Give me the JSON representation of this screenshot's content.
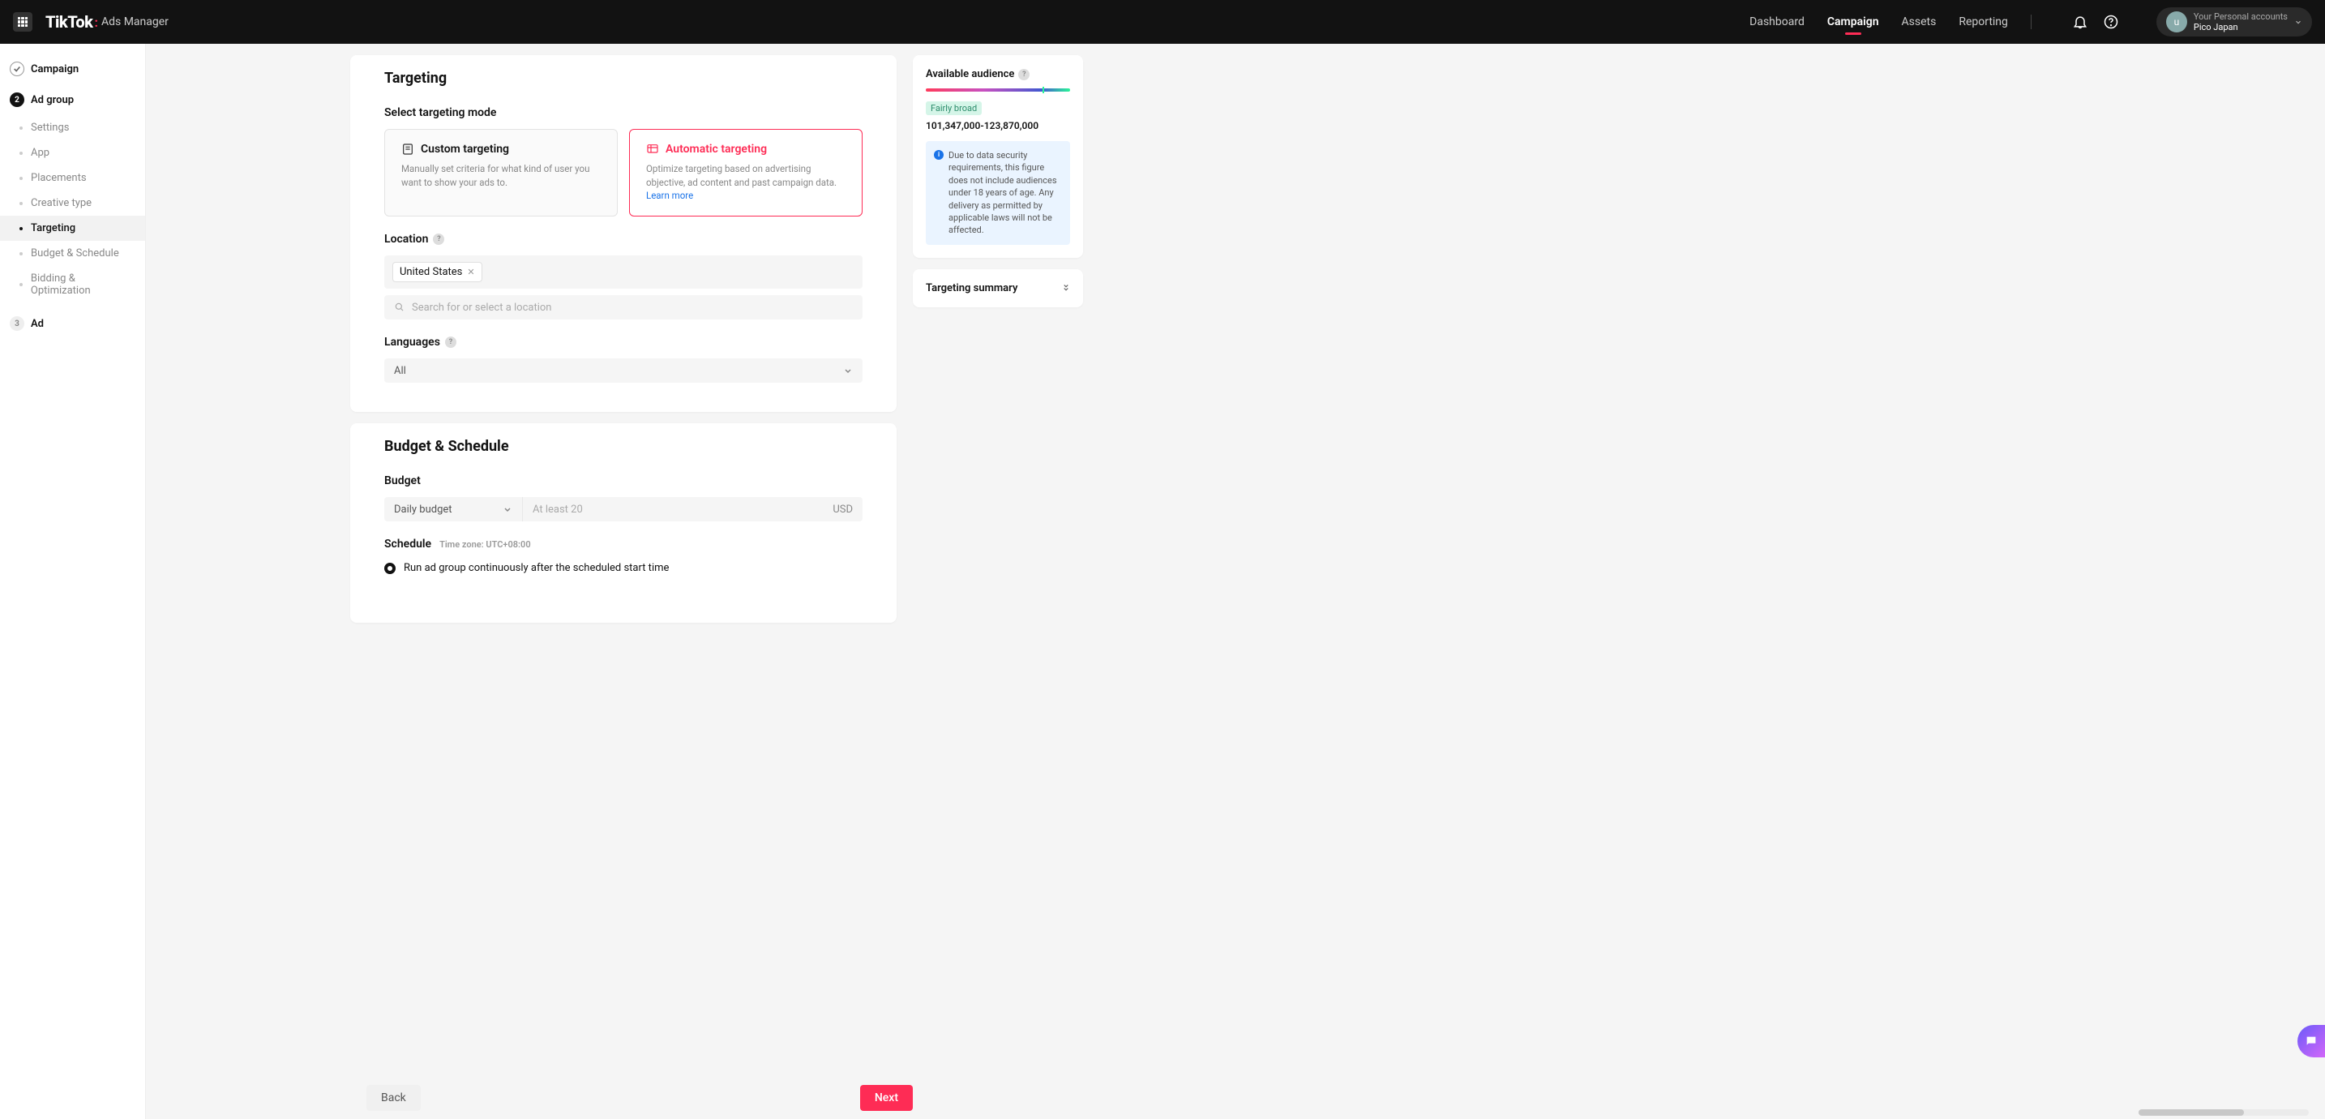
{
  "header": {
    "logo_prefix": "TikTok",
    "logo_suffix": "Ads Manager",
    "nav": {
      "dashboard": "Dashboard",
      "campaign": "Campaign",
      "assets": "Assets",
      "reporting": "Reporting"
    },
    "account": {
      "avatar_letter": "u",
      "line1": "Your Personal accounts",
      "line2": "Pico Japan"
    }
  },
  "sidebar": {
    "campaign_label": "Campaign",
    "adgroup_label": "Ad group",
    "adgroup_number": "2",
    "ad_label": "Ad",
    "ad_number": "3",
    "substeps": {
      "settings": "Settings",
      "app": "App",
      "placements": "Placements",
      "creative_type": "Creative type",
      "targeting": "Targeting",
      "budget_schedule": "Budget & Schedule",
      "bidding": "Bidding & Optimization"
    }
  },
  "targeting": {
    "heading": "Targeting",
    "mode_label": "Select targeting mode",
    "custom": {
      "title": "Custom targeting",
      "desc": "Manually set criteria for what kind of user you want to show your ads to."
    },
    "auto": {
      "title": "Automatic targeting",
      "desc": "Optimize targeting based on advertising objective, ad content and past campaign data. ",
      "learn_more": "Learn more"
    },
    "location_label": "Location",
    "location_chip": "United States",
    "location_search_placeholder": "Search for or select a location",
    "languages_label": "Languages",
    "languages_value": "All"
  },
  "budget_schedule": {
    "heading": "Budget & Schedule",
    "budget_label": "Budget",
    "budget_type": "Daily budget",
    "budget_placeholder": "At least 20",
    "currency": "USD",
    "schedule_label": "Schedule",
    "time_zone": "Time zone: UTC+08:00",
    "radio_text": "Run ad group continuously after the scheduled start time"
  },
  "right": {
    "audience_title": "Available audience",
    "audience_tag": "Fairly broad",
    "audience_range": "101,347,000-123,870,000",
    "info_text": "Due to data security requirements, this figure does not include audiences under 18 years of age. Any delivery as permitted by applicable laws will not be affected.",
    "targeting_summary": "Targeting summary"
  },
  "footer": {
    "back": "Back",
    "next": "Next"
  }
}
